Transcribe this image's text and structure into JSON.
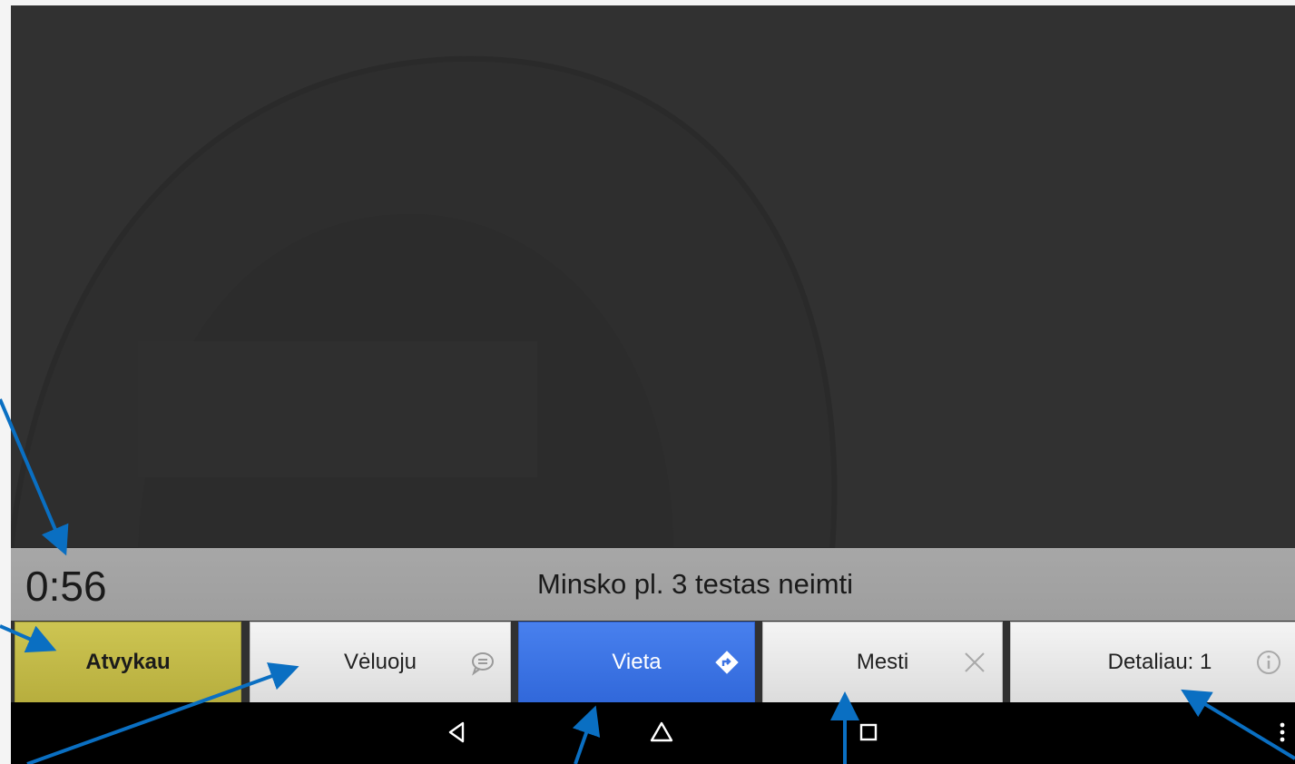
{
  "timer": "0:56",
  "address": "Minsko pl. 3 testas neimti",
  "buttons": {
    "arrive": "Atvykau",
    "late": "Vėluoju",
    "place": "Vieta",
    "drop": "Mesti",
    "details": "Detaliau: 1"
  },
  "icons": {
    "late": "chat-bubble-icon",
    "place": "directions-icon",
    "drop": "close-icon",
    "details": "info-icon",
    "nav_back": "back-icon",
    "nav_home": "home-icon",
    "nav_recents": "recents-icon",
    "nav_menu": "menu-dots-icon"
  },
  "colors": {
    "arrive": "#c4bb4a",
    "place": "#3d74e4",
    "annotation_arrow": "#0a6fc2"
  }
}
